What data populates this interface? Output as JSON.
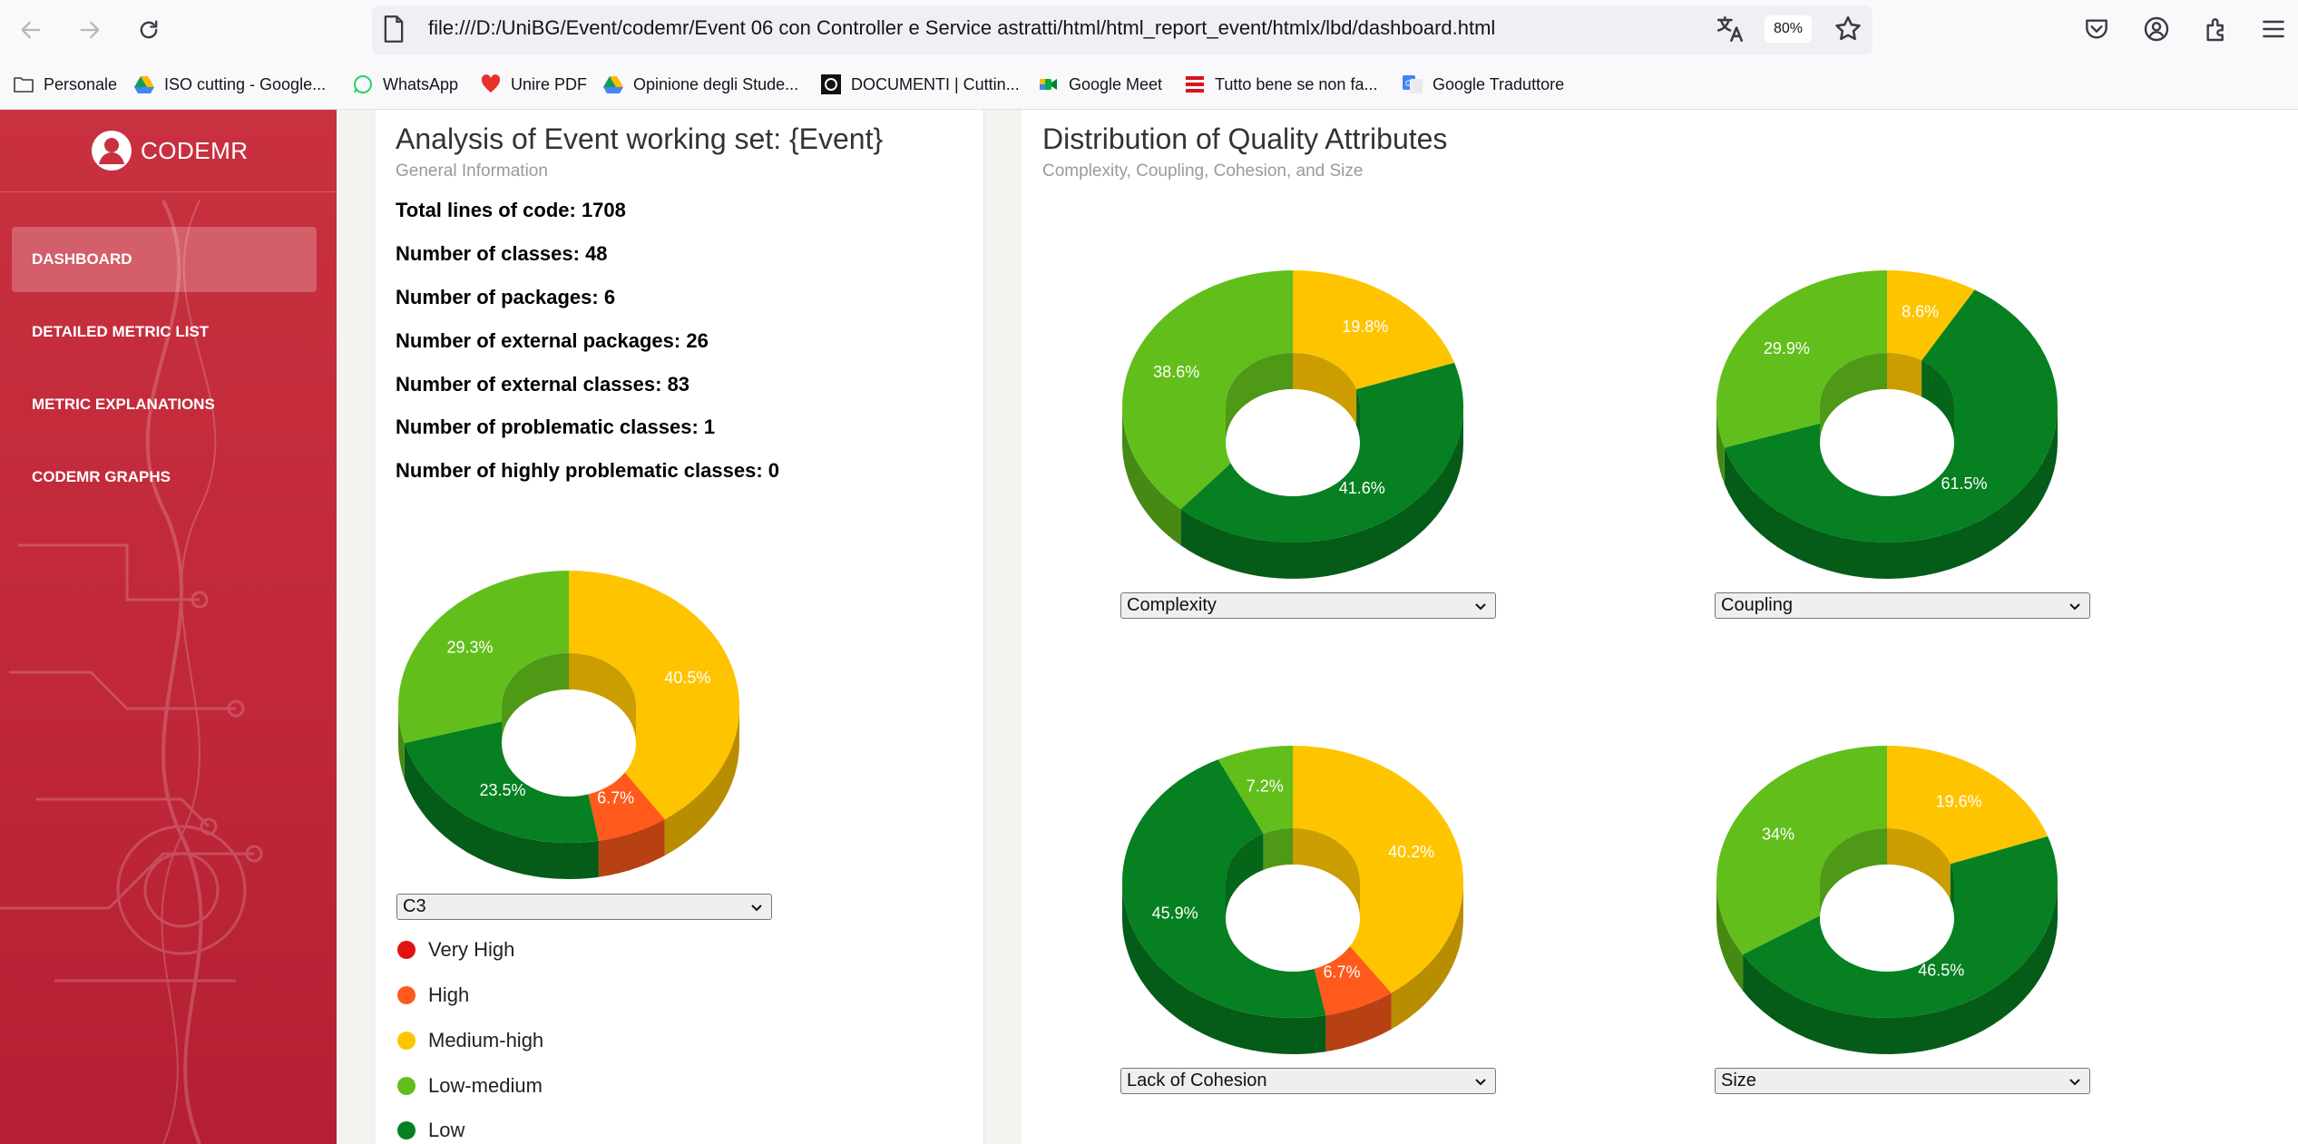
{
  "browser": {
    "url": "file:///D:/UniBG/Event/codemr/Event 06 con Controller e Service astratti/html/html_report_event/htmlx/lbd/dashboard.html",
    "zoom": "80%",
    "bookmarks": [
      {
        "label": "Personale",
        "icon": "folder-icon"
      },
      {
        "label": "ISO cutting - Google...",
        "icon": "google-drive-icon"
      },
      {
        "label": "WhatsApp",
        "icon": "whatsapp-icon"
      },
      {
        "label": "Unire PDF",
        "icon": "heart-icon"
      },
      {
        "label": "Opinione degli Stude...",
        "icon": "google-drive-icon"
      },
      {
        "label": "DOCUMENTI | Cuttin...",
        "icon": "document-site-icon"
      },
      {
        "label": "Google Meet",
        "icon": "google-meet-icon"
      },
      {
        "label": "Tutto bene se non fa...",
        "icon": "trenitalia-icon"
      },
      {
        "label": "Google Traduttore",
        "icon": "google-translate-icon"
      }
    ]
  },
  "sidebar": {
    "logo_text": "CODEMR",
    "items": [
      {
        "label": "DASHBOARD",
        "active": true
      },
      {
        "label": "DETAILED METRIC LIST",
        "active": false
      },
      {
        "label": "METRIC EXPLANATIONS",
        "active": false
      },
      {
        "label": "CODEMR GRAPHS",
        "active": false
      }
    ]
  },
  "left_card": {
    "title": "Analysis of Event working set: {Event}",
    "subtitle": "General Information",
    "stats": [
      {
        "text": "Total lines of code: 1708",
        "color": "#1cb8d6"
      },
      {
        "text": "Number of classes: 48",
        "color": "#7ac51f"
      },
      {
        "text": "Number of packages: 6",
        "color": "#7ac51f"
      },
      {
        "text": "Number of external packages: 26",
        "color": "#f5911e"
      },
      {
        "text": "Number of external classes: 83",
        "color": "#f5911e"
      },
      {
        "text": "Number of problematic classes: 1",
        "color": "#ed3a4e"
      },
      {
        "text": "Number of highly problematic classes: 0",
        "color": "#ed3a4e"
      }
    ],
    "select_value": "C3",
    "legend": [
      {
        "label": "Very High",
        "color": "#e21212"
      },
      {
        "label": "High",
        "color": "#ff5a1c"
      },
      {
        "label": "Medium-high",
        "color": "#ffc400"
      },
      {
        "label": "Low-medium",
        "color": "#62bf1b"
      },
      {
        "label": "Low",
        "color": "#068021"
      }
    ]
  },
  "right_card": {
    "title": "Distribution of Quality Attributes",
    "subtitle": "Complexity, Coupling, Cohesion, and Size"
  },
  "colors": {
    "very_high": "#e21212",
    "high": "#ff5a1c",
    "medium_high": "#ffc400",
    "low_medium": "#62bf1b",
    "low": "#068021"
  },
  "chart_data": [
    {
      "type": "pie",
      "select": "C3",
      "slices": [
        {
          "level": "Medium-high",
          "value": 40.5,
          "label": "40.5%"
        },
        {
          "level": "High",
          "value": 6.7,
          "label": "6.7%"
        },
        {
          "level": "Low",
          "value": 23.5,
          "label": "23.5%"
        },
        {
          "level": "Low-medium",
          "value": 29.3,
          "label": "29.3%"
        }
      ]
    },
    {
      "type": "pie",
      "select": "Complexity",
      "slices": [
        {
          "level": "Medium-high",
          "value": 19.8,
          "label": "19.8%"
        },
        {
          "level": "Low",
          "value": 41.6,
          "label": "41.6%"
        },
        {
          "level": "Low-medium",
          "value": 38.6,
          "label": "38.6%"
        }
      ]
    },
    {
      "type": "pie",
      "select": "Coupling",
      "slices": [
        {
          "level": "Medium-high",
          "value": 8.6,
          "label": "8.6%"
        },
        {
          "level": "Low",
          "value": 61.5,
          "label": "61.5%"
        },
        {
          "level": "Low-medium",
          "value": 29.9,
          "label": "29.9%"
        }
      ]
    },
    {
      "type": "pie",
      "select": "Lack of Cohesion",
      "slices": [
        {
          "level": "Medium-high",
          "value": 40.2,
          "label": "40.2%"
        },
        {
          "level": "High",
          "value": 6.7,
          "label": "6.7%"
        },
        {
          "level": "Low",
          "value": 45.9,
          "label": "45.9%"
        },
        {
          "level": "Low-medium",
          "value": 7.2,
          "label": "7.2%"
        }
      ]
    },
    {
      "type": "pie",
      "select": "Size",
      "slices": [
        {
          "level": "Medium-high",
          "value": 19.6,
          "label": "19.6%"
        },
        {
          "level": "Low",
          "value": 46.5,
          "label": "46.5%"
        },
        {
          "level": "Low-medium",
          "value": 34,
          "label": "34%"
        }
      ]
    }
  ]
}
